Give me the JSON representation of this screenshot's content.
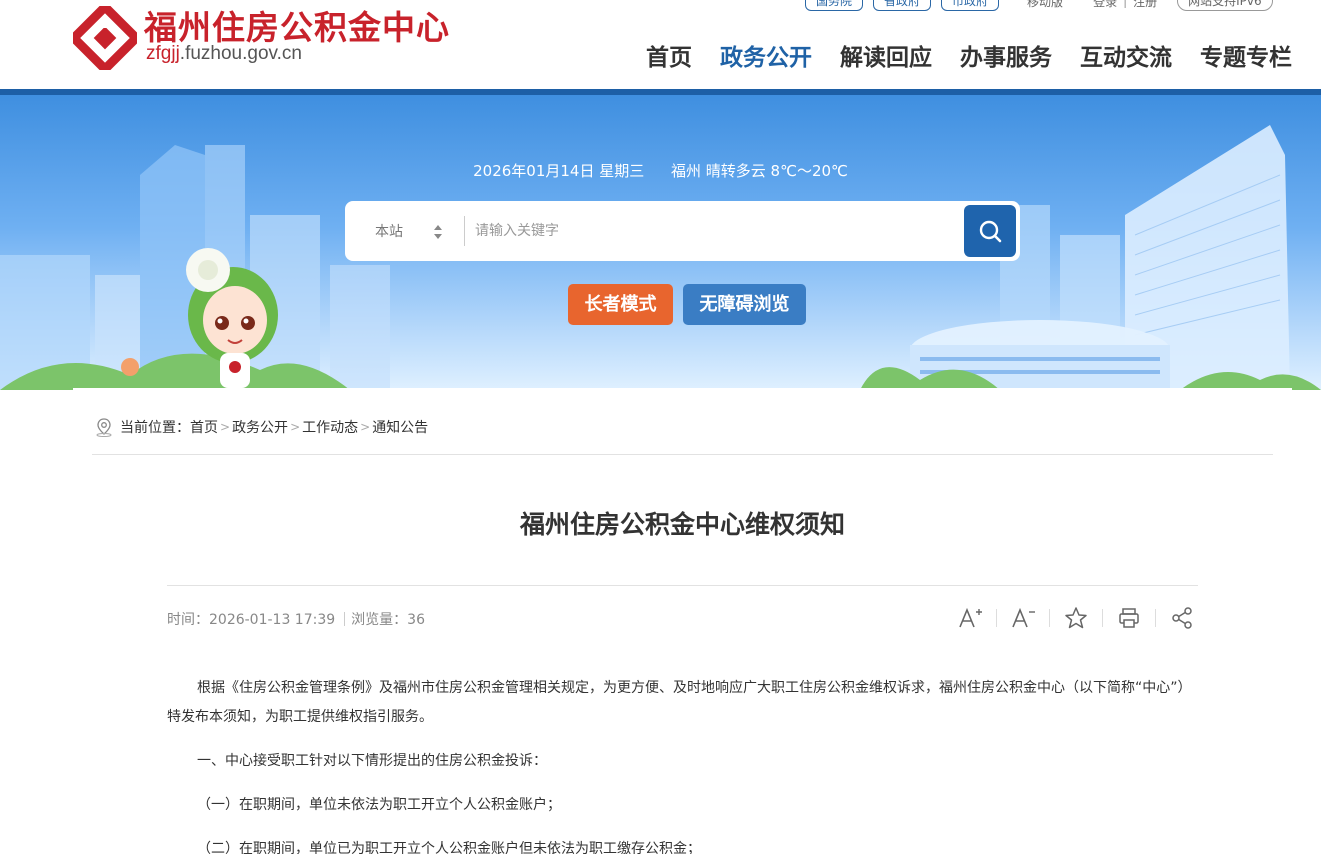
{
  "header": {
    "logo_cn": "福州住房公积金中心",
    "logo_en_highlight": "zfgjj",
    "logo_en_rest": ".fuzhou.gov.cn",
    "top_links": [
      "国务院",
      "省政府",
      "市政府"
    ],
    "mobile": "移动版",
    "login": "登录",
    "register": "注册",
    "ipv6": "网站支持IPv6",
    "nav": [
      {
        "label": "首页",
        "active": false
      },
      {
        "label": "政务公开",
        "active": true
      },
      {
        "label": "解读回应",
        "active": false
      },
      {
        "label": "办事服务",
        "active": false
      },
      {
        "label": "互动交流",
        "active": false
      },
      {
        "label": "专题专栏",
        "active": false
      }
    ]
  },
  "banner": {
    "date": "2026年01月14日 星期三",
    "weather": "福州 晴转多云 8℃～20℃",
    "search_scope": "本站",
    "search_placeholder": "请输入关键字",
    "elder_mode": "长者模式",
    "accessible_mode": "无障碍浏览"
  },
  "breadcrumb": {
    "prefix": "当前位置：",
    "items": [
      "首页",
      "政务公开",
      "工作动态",
      "通知公告"
    ]
  },
  "article": {
    "title": "福州住房公积金中心维权须知",
    "time_label": "时间：",
    "time": "2026-01-13 17:39",
    "views_label": "浏览量：",
    "views": "36",
    "paragraphs": [
      "根据《住房公积金管理条例》及福州市住房公积金管理相关规定，为更方便、及时地响应广大职工住房公积金维权诉求，福州住房公积金中心（以下简称“中心”）特发布本须知，为职工提供维权指引服务。",
      "一、中心接受职工针对以下情形提出的住房公积金投诉：",
      "（一）在职期间，单位未依法为职工开立个人公积金账户；",
      "（二）在职期间，单位已为职工开立个人公积金账户但未依法为职工缴存公积金；"
    ]
  },
  "colors": {
    "brand_red": "#c8222b",
    "nav_blue": "#1f62a6",
    "elder_orange": "#e8652e",
    "access_blue": "#3a7dc4"
  }
}
